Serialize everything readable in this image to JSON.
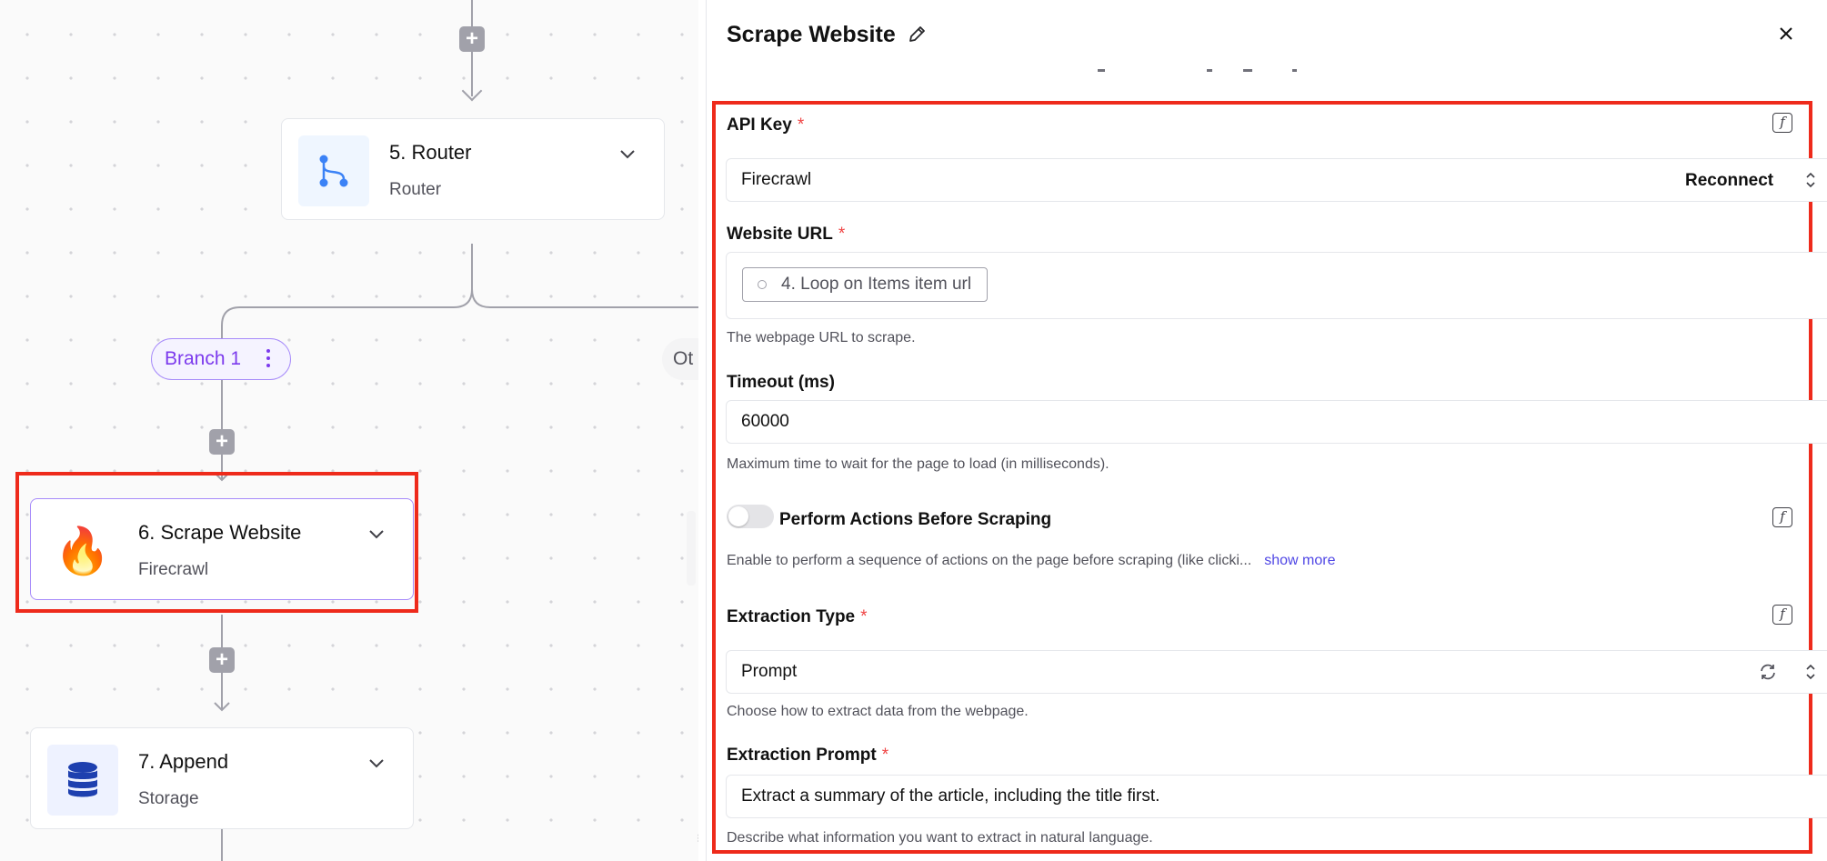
{
  "canvas": {
    "nodes": [
      {
        "title": "5. Router",
        "subtitle": "Router",
        "icon": "router-branch-icon"
      },
      {
        "title": "6. Scrape Website",
        "subtitle": "Firecrawl",
        "icon": "fire-icon"
      },
      {
        "title": "7. Append",
        "subtitle": "Storage",
        "icon": "database-icon"
      }
    ],
    "branch_label": "Branch 1",
    "other_branch_label": "Ot",
    "plus_symbol": "+",
    "resize_handle": "⠿"
  },
  "panel": {
    "title": "Scrape Website",
    "close_symbol": "×",
    "fields": {
      "api_key": {
        "label": "API Key",
        "required": "*",
        "value": "Firecrawl",
        "action": "Reconnect"
      },
      "website_url": {
        "label": "Website URL",
        "required": "*",
        "chip": "4. Loop on Items item url",
        "help": "The webpage URL to scrape."
      },
      "timeout": {
        "label": "Timeout (ms)",
        "value": "60000",
        "help": "Maximum time to wait for the page to load (in milliseconds)."
      },
      "perform_actions": {
        "label": "Perform Actions Before Scraping",
        "help": "Enable to perform a sequence of actions on the page before scraping (like clicki...",
        "show_more": "show more",
        "enabled": false
      },
      "extraction_type": {
        "label": "Extraction Type",
        "required": "*",
        "value": "Prompt",
        "help": "Choose how to extract data from the webpage."
      },
      "extraction_prompt": {
        "label": "Extraction Prompt",
        "required": "*",
        "value": "Extract a summary of the article, including the title first.",
        "help": "Describe what information you want to extract in natural language."
      }
    },
    "fx_symbol": "f"
  },
  "colors": {
    "highlight": "#ee2a1b",
    "branch": "#7c3aed",
    "link": "#4f46e5",
    "required": "#ef4444"
  }
}
